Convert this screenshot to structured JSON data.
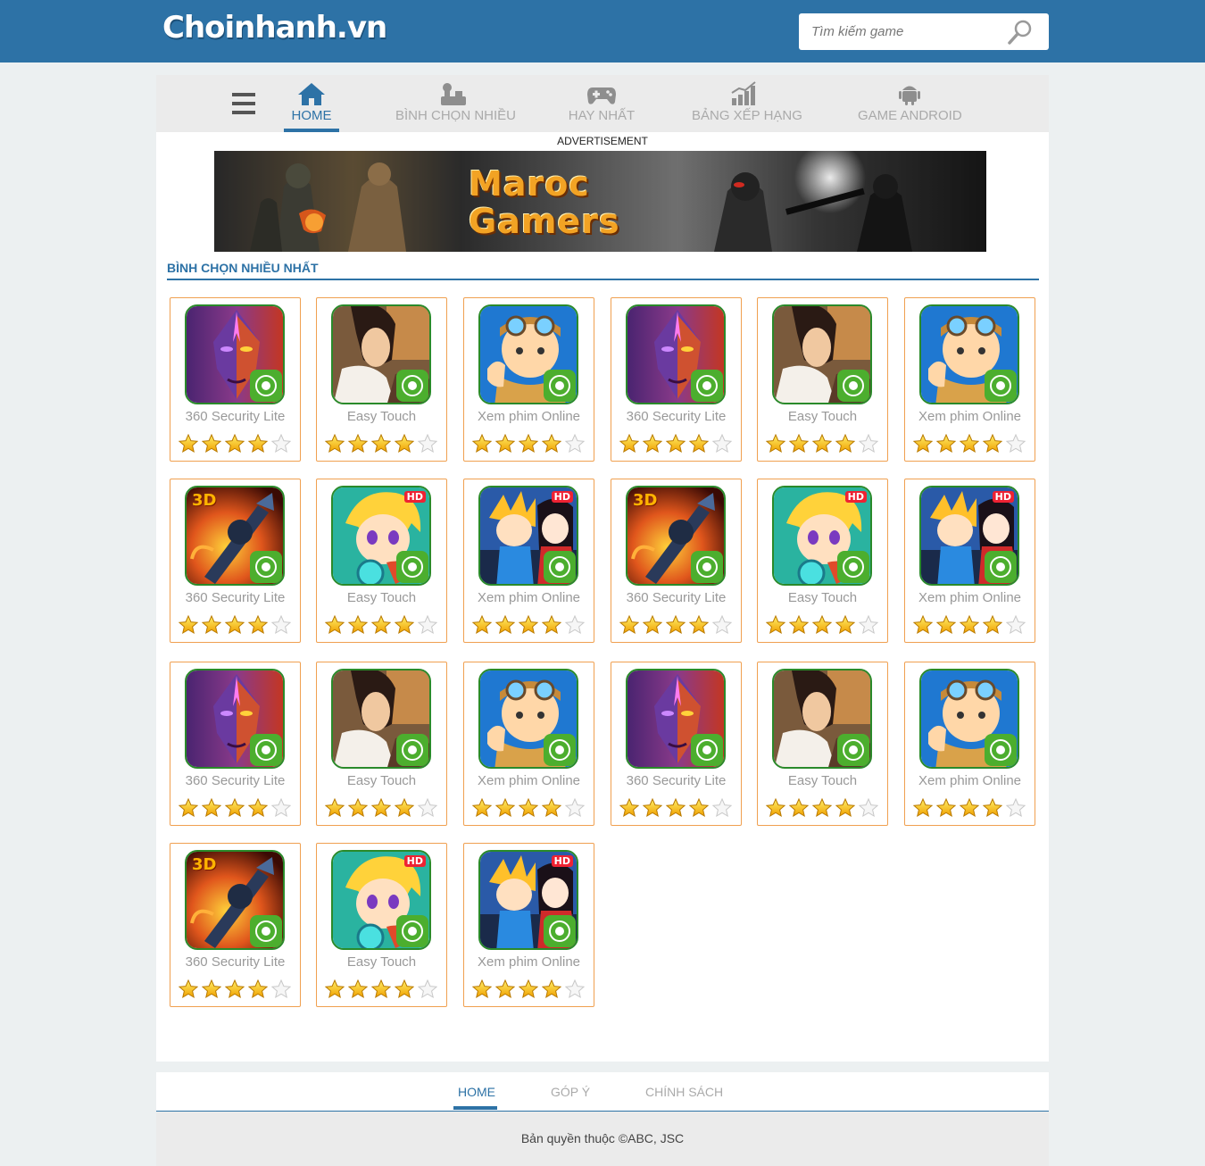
{
  "header": {
    "logo": "Choinhanh.vn",
    "search_placeholder": "Tìm kiếm game",
    "brand_color": "#2d72a6"
  },
  "nav": {
    "items": [
      {
        "label": "HOME",
        "icon": "home-icon",
        "active": true
      },
      {
        "label": "BÌNH CHỌN NHIỀU",
        "icon": "joystick-icon",
        "active": false
      },
      {
        "label": "HAY NHẤT",
        "icon": "gamepad-icon",
        "active": false
      },
      {
        "label": "BẢNG XẾP HẠNG",
        "icon": "bar-chart-icon",
        "active": false
      },
      {
        "label": "GAME ANDROID",
        "icon": "android-icon",
        "active": false
      }
    ]
  },
  "ad": {
    "label": "ADVERTISEMENT",
    "banner_text_line1": "Maroc",
    "banner_text_line2": "Gamers"
  },
  "section": {
    "title": "BÌNH CHỌN NHIỀU NHẤT"
  },
  "games": [
    {
      "name": "360 Security Lite",
      "art": "sorceress",
      "rating": 4,
      "max_rating": 5
    },
    {
      "name": "Easy Touch",
      "art": "warrior",
      "rating": 4,
      "max_rating": 5
    },
    {
      "name": "Xem phim Online",
      "art": "aviator",
      "rating": 4,
      "max_rating": 5
    },
    {
      "name": "360 Security Lite",
      "art": "sorceress",
      "rating": 4,
      "max_rating": 5
    },
    {
      "name": "Easy Touch",
      "art": "warrior",
      "rating": 4,
      "max_rating": 5
    },
    {
      "name": "Xem phim Online",
      "art": "aviator",
      "rating": 4,
      "max_rating": 5
    },
    {
      "name": "360 Security Lite",
      "art": "sword3d",
      "rating": 4,
      "max_rating": 5
    },
    {
      "name": "Easy Touch",
      "art": "blondehd",
      "rating": 4,
      "max_rating": 5
    },
    {
      "name": "Xem phim Online",
      "art": "duohd",
      "rating": 4,
      "max_rating": 5
    },
    {
      "name": "360 Security Lite",
      "art": "sword3d",
      "rating": 4,
      "max_rating": 5
    },
    {
      "name": "Easy Touch",
      "art": "blondehd",
      "rating": 4,
      "max_rating": 5
    },
    {
      "name": "Xem phim Online",
      "art": "duohd",
      "rating": 4,
      "max_rating": 5
    },
    {
      "name": "360 Security Lite",
      "art": "sorceress",
      "rating": 4,
      "max_rating": 5
    },
    {
      "name": "Easy Touch",
      "art": "warrior",
      "rating": 4,
      "max_rating": 5
    },
    {
      "name": "Xem phim Online",
      "art": "aviator",
      "rating": 4,
      "max_rating": 5
    },
    {
      "name": "360 Security Lite",
      "art": "sorceress",
      "rating": 4,
      "max_rating": 5
    },
    {
      "name": "Easy Touch",
      "art": "warrior",
      "rating": 4,
      "max_rating": 5
    },
    {
      "name": "Xem phim Online",
      "art": "aviator",
      "rating": 4,
      "max_rating": 5
    },
    {
      "name": "360 Security Lite",
      "art": "sword3d",
      "rating": 4,
      "max_rating": 5
    },
    {
      "name": "Easy Touch",
      "art": "blondehd",
      "rating": 4,
      "max_rating": 5
    },
    {
      "name": "Xem phim Online",
      "art": "duohd",
      "rating": 4,
      "max_rating": 5
    }
  ],
  "badges": {
    "hd": "HD",
    "three_d": "3D"
  },
  "footer": {
    "nav": [
      {
        "label": "HOME",
        "active": true
      },
      {
        "label": "GÓP Ý",
        "active": false
      },
      {
        "label": "CHÍNH SÁCH",
        "active": false
      }
    ],
    "copyright": "Bản quyền thuộc ©ABC, JSC"
  }
}
